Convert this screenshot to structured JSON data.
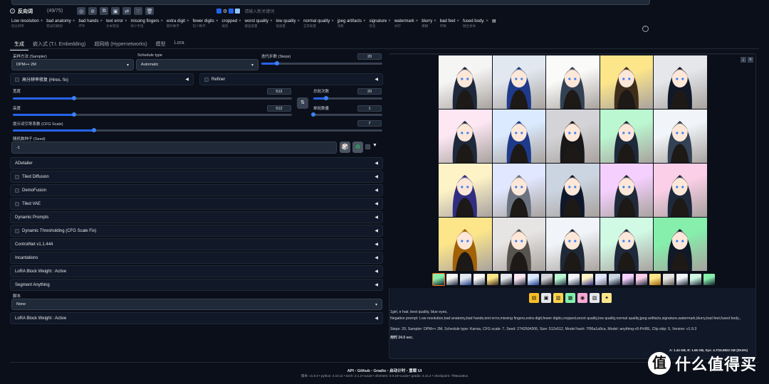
{
  "topbar": {
    "neg_label": "反向词",
    "token_count": "(49/75)",
    "checkbox_label": "请输入新关键词"
  },
  "tags": [
    {
      "t": "Low resolution",
      "sub": "低分辨率"
    },
    {
      "t": "bad anatomy",
      "sub": "错误的解剖"
    },
    {
      "t": "bad hands",
      "sub": "坏手"
    },
    {
      "t": "text error",
      "sub": "文本错误"
    },
    {
      "t": "missing fingers",
      "sub": "缺少手指"
    },
    {
      "t": "extra digit",
      "sub": "额外数字"
    },
    {
      "t": "fewer digits",
      "sub": "较少数字"
    },
    {
      "t": "cropped",
      "sub": "裁剪"
    },
    {
      "t": "worst quality",
      "sub": "最差质量"
    },
    {
      "t": "low quality",
      "sub": "低质量"
    },
    {
      "t": "normal quality",
      "sub": "正常质量"
    },
    {
      "t": "jpeg artifacts",
      "sub": "伪影"
    },
    {
      "t": "signature",
      "sub": "签名"
    },
    {
      "t": "watermark",
      "sub": "水印"
    },
    {
      "t": "blurry",
      "sub": "模糊"
    },
    {
      "t": "bad feet",
      "sub": "坏脚"
    },
    {
      "t": "fused body.",
      "sub": "融合身体"
    }
  ],
  "tabs": [
    "生成",
    "嵌入式 (T.I. Embedding)",
    "超网络 (Hypernetworks)",
    "模型",
    "Lora"
  ],
  "sampler": {
    "label": "采样方法 (Sampler)",
    "value": "DPM++ 2M"
  },
  "schedule": {
    "label": "Schedule type",
    "value": "Automatic"
  },
  "steps": {
    "label": "迭代步数 (Steps)",
    "value": "20",
    "fraction": 0.13
  },
  "hires": {
    "label": "高分辨率修复 (Hires. fix)"
  },
  "refiner": {
    "label": "Refiner"
  },
  "width": {
    "label": "宽度",
    "value": "512",
    "fraction": 0.22
  },
  "height": {
    "label": "高度",
    "value": "512",
    "fraction": 0.22
  },
  "batch_count": {
    "label": "总批次数",
    "value": "20",
    "fraction": 0.19
  },
  "batch_size": {
    "label": "单批数量",
    "value": "1",
    "fraction": 0.0
  },
  "cfg": {
    "label": "提示词引导系数 (CFG Scale)",
    "value": "7",
    "fraction": 0.22
  },
  "seed": {
    "label": "随机数种子 (Seed)",
    "value": "-1"
  },
  "accordions": [
    {
      "label": "ADetailer",
      "cb": false
    },
    {
      "label": "Tiled Diffusion",
      "cb": true
    },
    {
      "label": "DemoFusion",
      "cb": true
    },
    {
      "label": "Tiled VAE",
      "cb": true
    },
    {
      "label": "Dynamic Prompts",
      "cb": false
    },
    {
      "label": "Dynamic Thresholding (CFG Scale Fix)",
      "cb": true
    },
    {
      "label": "ControlNet v1.1.444",
      "cb": false
    },
    {
      "label": "Incantations",
      "cb": false
    },
    {
      "label": "LoRA Block Weight : Active",
      "cb": false
    },
    {
      "label": "Segment Anything",
      "cb": false
    }
  ],
  "script": {
    "label": "脚本",
    "value": "None"
  },
  "lora_bw": {
    "label": "LoRA Block Weight : Active"
  },
  "info": {
    "prompt": "1girl, e hair, best quality, blue eyes,",
    "negative": "Negative prompt: Low resolution,bad anatomy,bad hands,text error,missing fingers,extra digit,fewer digits,cropped,worst quality,low quality,normal quality,jpeg artifacts,signature,watermark,blurry,bad feet,fused body.,",
    "params": "Steps: 20, Sampler: DPM++ 2M, Schedule type: Karras, CFG scale: 7, Seed: 2742504306, Size: 512x512, Model hash: 7f96a1a9ca, Model: anything-v5-PrtRE, Clip skip: 5, Version: v1.9.3",
    "time": "用时 24.0 sec.",
    "vram": "A: 1.44 GB, R: 1.66 GB, Sys: 4.7/15.9922 GB (29.5%)"
  },
  "footer": {
    "links": [
      "API",
      "Github",
      "Gradio",
      "启动计时",
      "重载 UI"
    ],
    "versions": "版本: v1.9.3  •  python: 3.10.11  •  torch: 2.1.2+cu118  •  xformers: 0.0.23+cu118  •  gradio: 3.41.2  •  checkpoint: 7f96a1a9ca"
  },
  "watermark": "值 什么值得买",
  "colors": {
    "bg": "#0b0f19",
    "accent": "#2563eb",
    "orange": "#f97316"
  }
}
